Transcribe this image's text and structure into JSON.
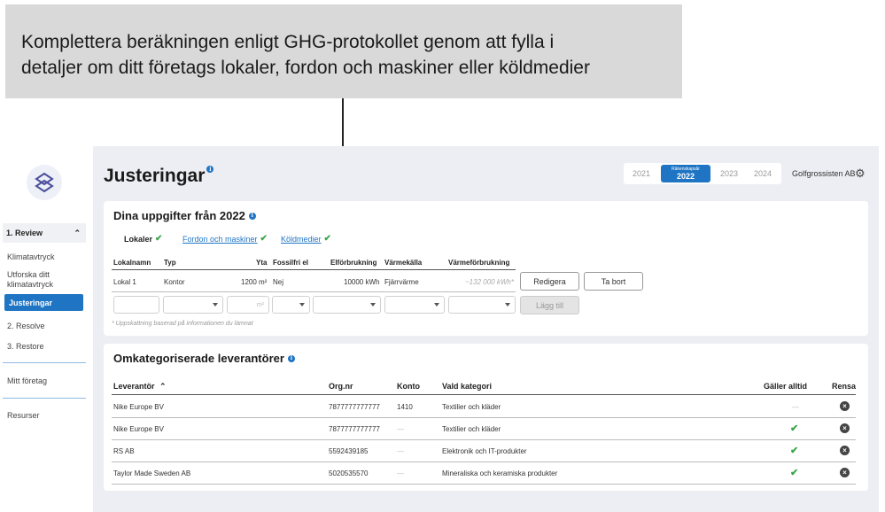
{
  "callout": {
    "text": "Komplettera beräkningen enligt GHG-protokollet genom att fylla i\ndetaljer om ditt företags lokaler, fordon och maskiner eller köldmedier"
  },
  "sidebar": {
    "review": "1. Review",
    "items": [
      "Klimatavtryck",
      "Utforska ditt klimatavtryck",
      "Justeringar"
    ],
    "resolve": "2. Resolve",
    "restore": "3. Restore",
    "company": "Mitt företag",
    "resources": "Resurser"
  },
  "header": {
    "title": "Justeringar",
    "years": [
      "2021",
      "2022",
      "2023",
      "2024"
    ],
    "active_year_label": "Räkenskapsår",
    "active_year": "2022",
    "company": "Golfgrossisten AB"
  },
  "card1": {
    "title": "Dina uppgifter från 2022",
    "tabs": [
      "Lokaler",
      "Fordon och maskiner",
      "Köldmedier"
    ],
    "columns": [
      "Lokalnamn",
      "Typ",
      "Yta",
      "Fossilfri el",
      "Elförbrukning",
      "Värmekälla",
      "Värmeförbrukning"
    ],
    "row": {
      "name": "Lokal 1",
      "type": "Kontor",
      "area": "1200 m²",
      "fossil_free": "Nej",
      "electricity": "10000 kWh",
      "heat_source": "Fjärrvärme",
      "heat_usage": "~132 000 kWh*"
    },
    "edit_label": "Redigera",
    "delete_label": "Ta bort",
    "area_unit": "m²",
    "add_label": "Lägg till",
    "note": "* Uppskattning baserad på informationen du lämnat"
  },
  "card2": {
    "title": "Omkategoriserade leverantörer",
    "columns": [
      "Leverantör",
      "Org.nr",
      "Konto",
      "Vald kategori",
      "Gäller alltid",
      "Rensa"
    ],
    "rows": [
      {
        "supplier": "Nike Europe BV",
        "org": "7877777777777",
        "account": "1410",
        "category": "Textilier och kläder",
        "always": false
      },
      {
        "supplier": "Nike Europe BV",
        "org": "7877777777777",
        "account": "—",
        "category": "Textilier och kläder",
        "always": true
      },
      {
        "supplier": "RS AB",
        "org": "5592439185",
        "account": "—",
        "category": "Elektronik och IT-produkter",
        "always": true
      },
      {
        "supplier": "Taylor Made Sweden AB",
        "org": "5020535570",
        "account": "—",
        "category": "Mineraliska och keramiska produkter",
        "always": true
      }
    ],
    "always_empty": "—"
  },
  "colors": {
    "accent": "#1f75c4",
    "check": "#3aa54a",
    "callout_bg": "#d9d9d9",
    "main_bg": "#eceef3"
  },
  "icons": [
    "logo-icon",
    "chevron-up-icon",
    "info-icon",
    "gear-icon",
    "check-icon",
    "chevron-down-icon",
    "clear-icon",
    "sort-up-icon"
  ]
}
